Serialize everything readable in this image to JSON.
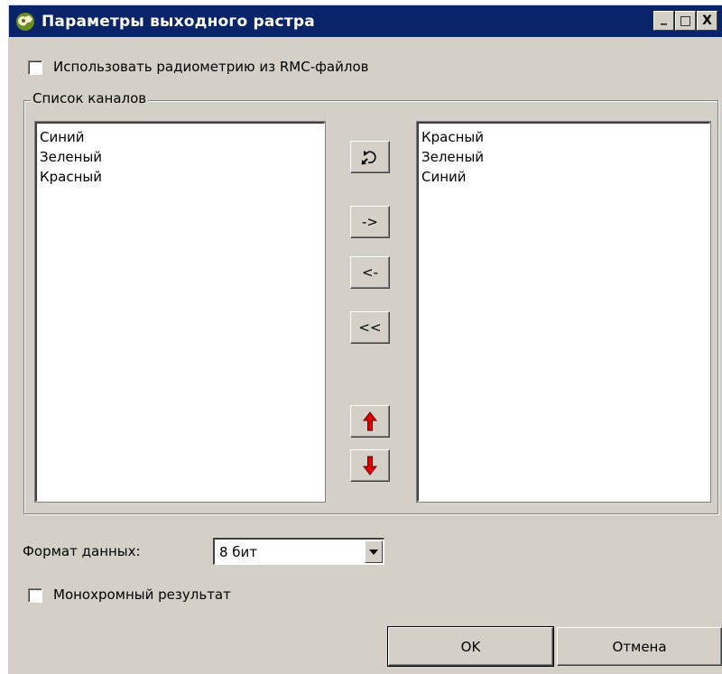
{
  "window": {
    "title": "Параметры выходного растра",
    "minimize_label": "_",
    "maximize_label": "□",
    "close_label": "X"
  },
  "use_radiometry": {
    "label": "Использовать радиометрию из RMC-файлов",
    "checked": false
  },
  "channels_group": {
    "title": "Список каналов",
    "left_list": [
      "Синий",
      "Зеленый",
      "Красный"
    ],
    "right_list": [
      "Красный",
      "Зеленый",
      "Синий"
    ],
    "add_label": "->",
    "remove_label": "<-",
    "remove_all_label": "<<"
  },
  "data_format": {
    "label": "Формат данных:",
    "value": "8 бит"
  },
  "monochrome": {
    "label": "Монохромный результат",
    "checked": false
  },
  "buttons": {
    "ok_label": "OK",
    "cancel_label": "Отмена"
  },
  "colors": {
    "title_bar": "#0a246a",
    "dialog_bg": "#d4d0c8",
    "arrow_red": "#e00000"
  }
}
